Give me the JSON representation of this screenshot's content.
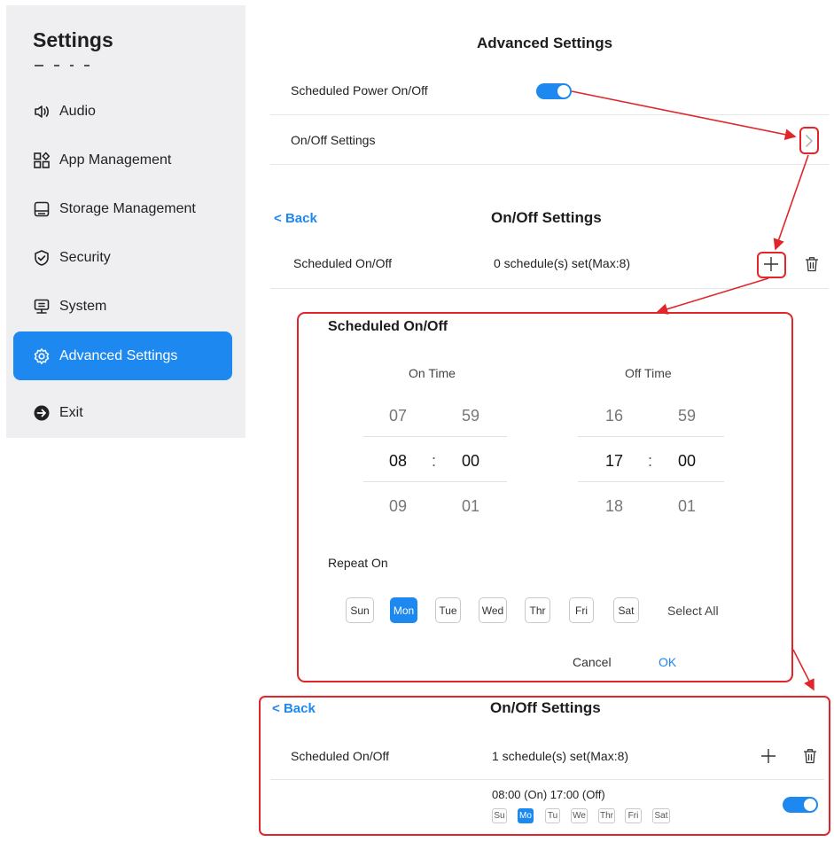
{
  "sidebar": {
    "title": "Settings",
    "items": [
      {
        "label": "Audio",
        "icon": "speaker-icon"
      },
      {
        "label": "App Management",
        "icon": "apps-icon"
      },
      {
        "label": "Storage Management",
        "icon": "storage-icon"
      },
      {
        "label": "Security",
        "icon": "shield-icon"
      },
      {
        "label": "System",
        "icon": "monitor-icon"
      },
      {
        "label": "Advanced Settings",
        "icon": "gear-icon",
        "active": true
      },
      {
        "label": "Exit",
        "icon": "exit-icon"
      }
    ]
  },
  "advanced": {
    "title": "Advanced Settings",
    "scheduled_power_label": "Scheduled Power On/Off",
    "scheduled_power_on": true,
    "onoff_settings_label": "On/Off Settings"
  },
  "onoff_before": {
    "back_label": "Back",
    "title": "On/Off Settings",
    "row_label": "Scheduled On/Off",
    "count_text": "0 schedule(s) set(Max:8)"
  },
  "dialog": {
    "title": "Scheduled On/Off",
    "on_time_label": "On Time",
    "off_time_label": "Off Time",
    "on_time": {
      "hour_prev": "07",
      "min_prev": "59",
      "hour": "08",
      "min": "00",
      "hour_next": "09",
      "min_next": "01"
    },
    "off_time": {
      "hour_prev": "16",
      "min_prev": "59",
      "hour": "17",
      "min": "00",
      "hour_next": "18",
      "min_next": "01"
    },
    "separator": ":",
    "repeat_label": "Repeat On",
    "days": [
      {
        "label": "Sun",
        "selected": false
      },
      {
        "label": "Mon",
        "selected": true
      },
      {
        "label": "Tue",
        "selected": false
      },
      {
        "label": "Wed",
        "selected": false
      },
      {
        "label": "Thr",
        "selected": false
      },
      {
        "label": "Fri",
        "selected": false
      },
      {
        "label": "Sat",
        "selected": false
      }
    ],
    "select_all_label": "Select All",
    "cancel_label": "Cancel",
    "ok_label": "OK"
  },
  "onoff_after": {
    "back_label": "Back",
    "title": "On/Off Settings",
    "row_label": "Scheduled On/Off",
    "count_text": "1 schedule(s) set(Max:8)",
    "schedule_text": "08:00 (On) 17:00 (Off)",
    "schedule_enabled": true,
    "mini_days": [
      {
        "label": "Su",
        "selected": false
      },
      {
        "label": "Mo",
        "selected": true
      },
      {
        "label": "Tu",
        "selected": false
      },
      {
        "label": "We",
        "selected": false
      },
      {
        "label": "Thr",
        "selected": false
      },
      {
        "label": "Fri",
        "selected": false
      },
      {
        "label": "Sat",
        "selected": false
      }
    ]
  },
  "colors": {
    "accent": "#1c88f0",
    "highlight": "#e0262b",
    "sidebar_bg": "#efeff1"
  }
}
